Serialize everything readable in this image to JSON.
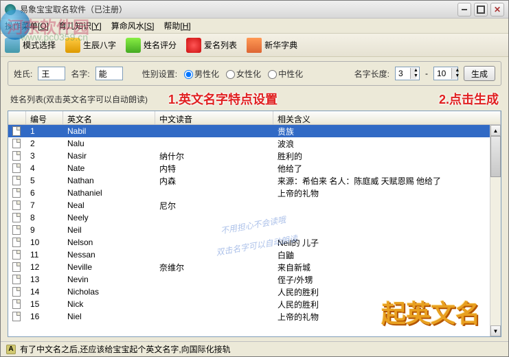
{
  "window": {
    "title": "易象宝宝取名软件（已注册）"
  },
  "menu": {
    "items": [
      {
        "label": "操作菜单",
        "accel": "[O]"
      },
      {
        "label": "育儿知识",
        "accel": "[Y]"
      },
      {
        "label": "算命风水",
        "accel": "[S]"
      },
      {
        "label": "帮助",
        "accel": "[H]"
      }
    ]
  },
  "toolbar": {
    "mode": "模式选择",
    "bazi": "生辰八字",
    "score": "姓名评分",
    "love": "爱名列表",
    "dict": "新华字典"
  },
  "config": {
    "surname_label": "姓氏:",
    "surname_value": "王",
    "given_label": "名字:",
    "given_value": "能",
    "gender_label": "性别设置:",
    "gender_male": "男性化",
    "gender_female": "女性化",
    "gender_neutral": "中性化",
    "gender_selected": "male",
    "length_label": "名字长度:",
    "length_min": "3",
    "length_max": "10",
    "dash": "-",
    "generate": "生成"
  },
  "annotations": {
    "list_header": "姓名列表(双击英文名字可以自动朗读)",
    "ann1": "1.英文名字特点设置",
    "ann2": "2.点击生成",
    "watermark_line1": "不用担心不会读哦",
    "watermark_line2": "双击名字可以自动朗读",
    "brand": "起英文名",
    "site_name": "河东软件园",
    "site_url": "www.pc0359.cn"
  },
  "table": {
    "columns": [
      "",
      "编号",
      "英文名",
      "中文读音",
      "相关含义"
    ],
    "rows": [
      {
        "num": "1",
        "en": "Nabil",
        "cn": "",
        "meaning": "贵族",
        "selected": true
      },
      {
        "num": "2",
        "en": "Nalu",
        "cn": "",
        "meaning": "波浪"
      },
      {
        "num": "3",
        "en": "Nasir",
        "cn": "纳什尔",
        "meaning": "胜利的"
      },
      {
        "num": "4",
        "en": "Nate",
        "cn": "内特",
        "meaning": "他给了"
      },
      {
        "num": "5",
        "en": "Nathan",
        "cn": "内森",
        "meaning": "来源：希伯来 名人：陈庭威 天赋恩赐 他给了"
      },
      {
        "num": "6",
        "en": "Nathaniel",
        "cn": "",
        "meaning": "上帝的礼物"
      },
      {
        "num": "7",
        "en": "Neal",
        "cn": "尼尔",
        "meaning": ""
      },
      {
        "num": "8",
        "en": "Neely",
        "cn": "",
        "meaning": ""
      },
      {
        "num": "9",
        "en": "Neil",
        "cn": "",
        "meaning": ""
      },
      {
        "num": "10",
        "en": "Nelson",
        "cn": "",
        "meaning": "Neil的 儿子"
      },
      {
        "num": "11",
        "en": "Nessan",
        "cn": "",
        "meaning": "白鼬"
      },
      {
        "num": "12",
        "en": "Neville",
        "cn": "奈维尔",
        "meaning": "来自新城"
      },
      {
        "num": "13",
        "en": "Nevin",
        "cn": "",
        "meaning": "侄子/外甥"
      },
      {
        "num": "14",
        "en": "Nicholas",
        "cn": "",
        "meaning": "人民的胜利"
      },
      {
        "num": "15",
        "en": "Nick",
        "cn": "",
        "meaning": "人民的胜利"
      },
      {
        "num": "16",
        "en": "Niel",
        "cn": "",
        "meaning": "上帝的礼物"
      }
    ]
  },
  "status": {
    "icon_letter": "A",
    "text": "有了中文名之后,还应该给宝宝起个英文名字,向国际化接轨"
  }
}
